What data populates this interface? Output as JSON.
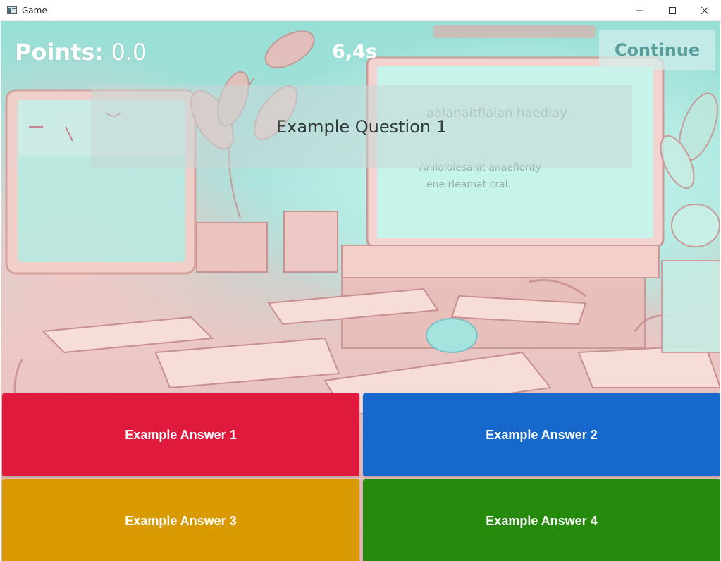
{
  "window": {
    "title": "Game",
    "icon": "app-window-icon",
    "controls": [
      "minimize-icon",
      "maximize-icon",
      "close-icon"
    ]
  },
  "hud": {
    "points_label": "Points:",
    "points_value": "0.0",
    "timer": "6,4s",
    "continue_label": "Continue"
  },
  "question": {
    "text": "Example Question 1"
  },
  "answers": [
    {
      "label": "Example Answer 1",
      "color": "#e01a3c"
    },
    {
      "label": "Example Answer 2",
      "color": "#1668cc"
    },
    {
      "label": "Example Answer 3",
      "color": "#d89a00"
    },
    {
      "label": "Example Answer 4",
      "color": "#268b0c"
    }
  ],
  "colors": {
    "continue_text": "#5a9e9e",
    "question_panel": "rgba(200, 215, 215, 0.55)",
    "hud_text": "#ffffff"
  }
}
